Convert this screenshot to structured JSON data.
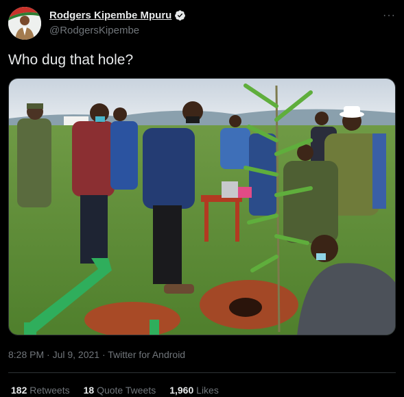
{
  "tweet": {
    "display_name": "Rodgers Kipembe Mpuru",
    "handle": "@RodgersKipembe",
    "verified_icon": "verified-badge-icon",
    "more_label": "···",
    "text": "Who dug that hole?",
    "timestamp": "8:28 PM · Jul 9, 2021 · Twitter for Android",
    "stats": {
      "retweets_count": "182",
      "retweets_label": "Retweets",
      "quotes_count": "18",
      "quotes_label": "Quote Tweets",
      "likes_count": "1,960",
      "likes_label": "Likes"
    }
  },
  "colors": {
    "background": "#000000",
    "text_primary": "#e7e9ea",
    "text_secondary": "#71767b",
    "divider": "#2f3336"
  }
}
